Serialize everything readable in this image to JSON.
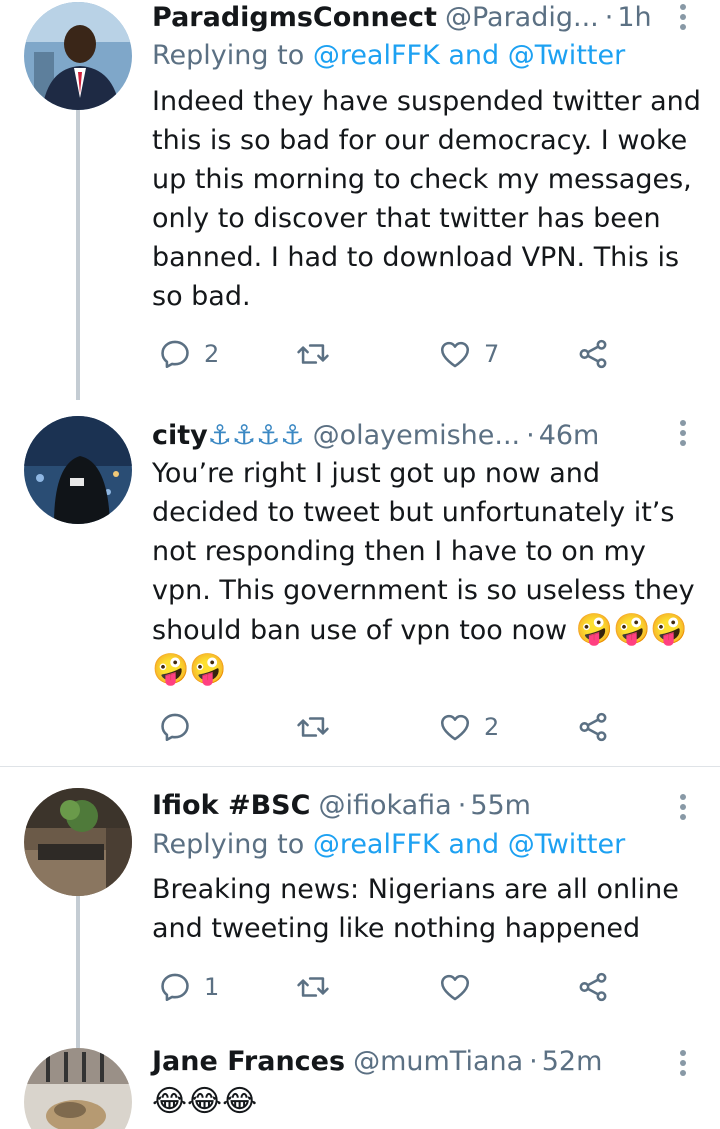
{
  "tweets": [
    {
      "name": "ParadigmsConnect",
      "handle": "@Paradig...",
      "dot": "·",
      "time": "1h",
      "replying_prefix": "Replying to ",
      "replying_mentions": "@realFFK and @Twitter",
      "text": "Indeed they have suspended twitter and this is so bad for our democracy. I woke up this morning to check my messages, only to discover that twitter has been banned. I had to download VPN. This is so bad.",
      "reply_count": "2",
      "retweet_count": "",
      "like_count": "7"
    },
    {
      "name": "city",
      "name_emoji": "⚓⚓⚓⚓",
      "handle": "@olayemishe...",
      "dot": "·",
      "time": "46m",
      "text": "You’re right I just got up now and decided to tweet but unfortunately it’s not responding then I have to on my vpn. This government is so useless they should ban use of vpn too now",
      "text_emoji": "🤪🤪🤪🤪🤪",
      "reply_count": "",
      "retweet_count": "",
      "like_count": "2"
    },
    {
      "name": "Ifiok #BSC",
      "handle": "@ifiokafia",
      "dot": "·",
      "time": "55m",
      "replying_prefix": "Replying to ",
      "replying_mentions": "@realFFK and @Twitter",
      "text": "Breaking news: Nigerians are all online and tweeting like nothing happened",
      "reply_count": "1",
      "retweet_count": "",
      "like_count": ""
    },
    {
      "name": "Jane Frances",
      "handle": "@mumTiana",
      "dot": "·",
      "time": "52m",
      "text_emoji": "😂😂😂"
    }
  ],
  "icons": {
    "reply": "reply-icon",
    "retweet": "retweet-icon",
    "like": "heart-icon",
    "share": "share-icon",
    "more": "more-icon"
  },
  "colors": {
    "link": "#1da1f2",
    "secondary_text": "#5b7083",
    "thread_line": "#c4ccd3"
  }
}
